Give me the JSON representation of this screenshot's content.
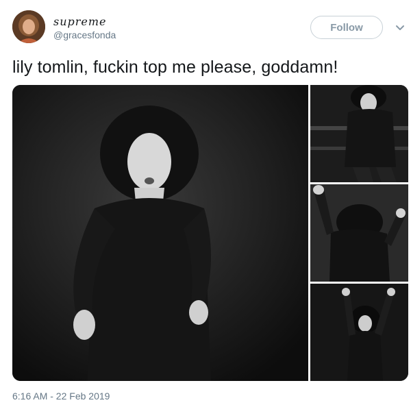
{
  "user": {
    "display_name": "supreme",
    "handle": "@gracesfonda",
    "avatar_icon": "profile-photo"
  },
  "actions": {
    "follow_label": "Follow",
    "more_icon": "chevron-down-icon"
  },
  "tweet": {
    "text": "lily tomlin, fuckin top me please, goddamn!",
    "timestamp": "6:16 AM - 22 Feb 2019"
  },
  "colors": {
    "text": "#14171a",
    "secondary": "#657786",
    "button_border": "#c7d0d6",
    "button_text": "#8899a6"
  }
}
